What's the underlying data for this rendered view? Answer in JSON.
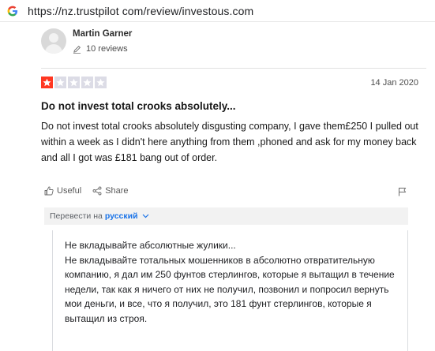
{
  "browser": {
    "url": "https://nz.trustpilot com/review/investous.com"
  },
  "reviewer": {
    "name": "Martin Garner",
    "review_count": "10 reviews"
  },
  "review": {
    "rating": 1,
    "max_rating": 5,
    "date": "14 Jan 2020",
    "title": "Do not invest total crooks absolutely...",
    "body": "Do not invest total crooks absolutely disgusting company, I gave them£250 I pulled out within a week as I didn't here anything from them ,phoned and ask for my money back and all I got was £181 bang out of order."
  },
  "actions": {
    "useful_label": "Useful",
    "share_label": "Share"
  },
  "translation": {
    "prefix": "Перевести на",
    "language": "русский",
    "title": "Не вкладывайте абсолютные жулики...",
    "body": "Не вкладывайте тотальных мошенников в абсолютно отвратительную компанию, я дал им 250 фунтов стерлингов, которые я вытащил в течение недели, так как я ничего от них не получил, позвонил и попросил вернуть мои деньги, и все, что я получил, это 181 фунт стерлингов, которые я вытащил из строя."
  },
  "colors": {
    "star_filled": "#ff3722",
    "star_empty": "#dcdce6",
    "link_blue": "#1a73e8"
  }
}
